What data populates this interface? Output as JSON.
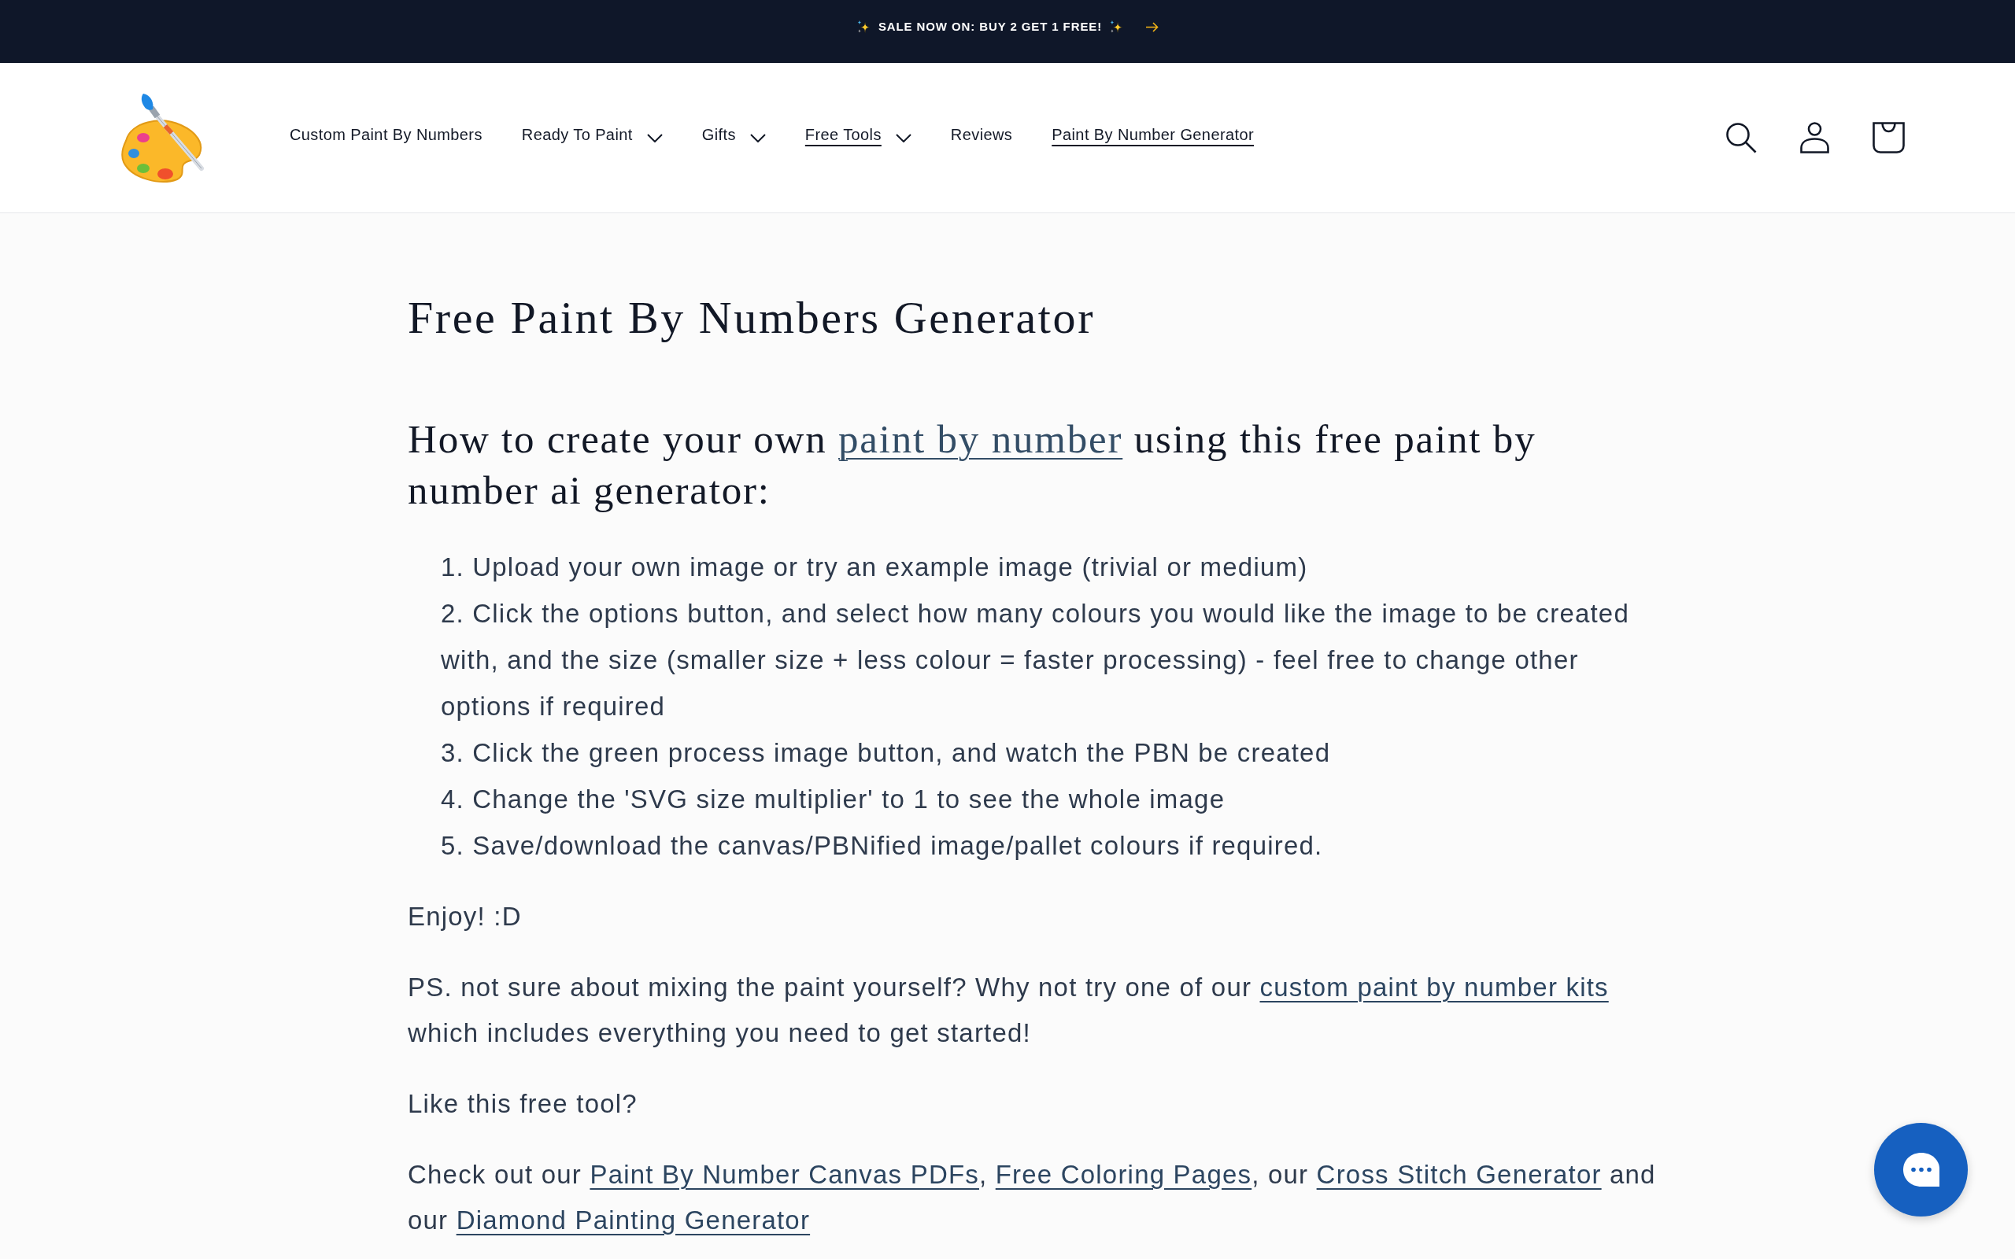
{
  "announcement": {
    "text": "SALE NOW ON: BUY 2 GET 1 FREE!"
  },
  "header": {
    "nav": [
      {
        "label": "Custom Paint By Numbers",
        "kind": "link",
        "selected": false
      },
      {
        "label": "Ready To Paint",
        "kind": "menu",
        "selected": false
      },
      {
        "label": "Gifts",
        "kind": "menu",
        "selected": false
      },
      {
        "label": "Free Tools",
        "kind": "menu",
        "selected": true
      },
      {
        "label": "Reviews",
        "kind": "link",
        "selected": false
      },
      {
        "label": "Paint By Number Generator",
        "kind": "link",
        "selected": true
      }
    ]
  },
  "content": {
    "title": "Free Paint By Numbers Generator",
    "intro": [
      {
        "kind": "text",
        "text": "How to create your own "
      },
      {
        "kind": "link",
        "text": "paint by number"
      },
      {
        "kind": "text",
        "text": " using this free paint by number ai generator:"
      }
    ],
    "steps": [
      "1. Upload your own image or try an example image (trivial or medium)",
      "2. Click the options button, and select how many colours you would like the image to be created with, and the size (smaller size + less colour = faster processing) - feel free to change other options if required",
      "3. Click the green process image button, and watch the PBN be created",
      "4. Change the 'SVG size multiplier' to 1 to see the whole image",
      "5. Save/download the canvas/PBNified image/pallet colours if required."
    ],
    "paragraphs": [
      {
        "segments": [
          {
            "kind": "text",
            "text": "Enjoy! :D"
          }
        ]
      },
      {
        "segments": [
          {
            "kind": "text",
            "text": "PS. not sure about mixing the paint yourself? Why not try one of our "
          },
          {
            "kind": "link",
            "text": "custom paint by number kits"
          },
          {
            "kind": "text",
            "text": " which includes everything you need to get started!"
          }
        ]
      },
      {
        "segments": [
          {
            "kind": "text",
            "text": "Like this free tool?"
          }
        ]
      },
      {
        "segments": [
          {
            "kind": "text",
            "text": "Check out our "
          },
          {
            "kind": "link",
            "text": "Paint By Number Canvas PDFs"
          },
          {
            "kind": "text",
            "text": ", "
          },
          {
            "kind": "link",
            "text": "Free Coloring Pages"
          },
          {
            "kind": "text",
            "text": ", our "
          },
          {
            "kind": "link",
            "text": "Cross Stitch Generator"
          },
          {
            "kind": "text",
            "text": " and our "
          },
          {
            "kind": "link",
            "text": "Diamond Painting Generator"
          }
        ]
      }
    ]
  }
}
